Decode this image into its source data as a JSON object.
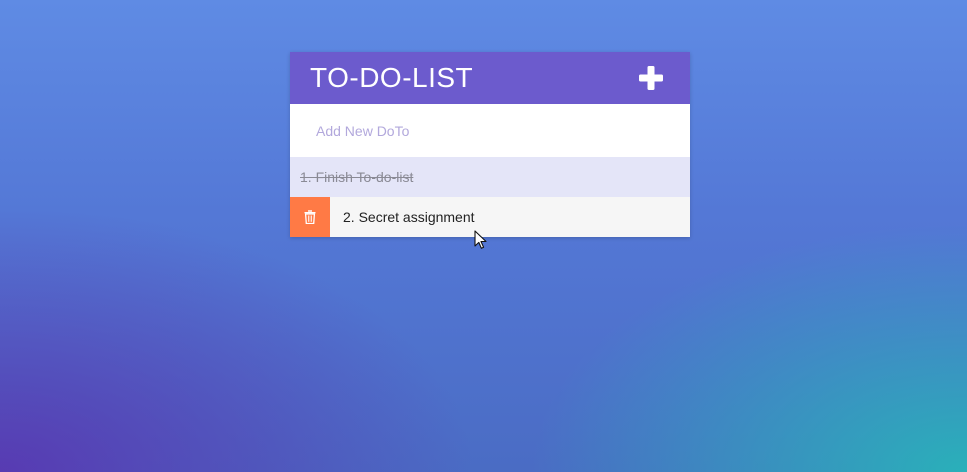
{
  "app": {
    "title": "TO-DO-LIST",
    "add_icon": "plus-icon",
    "colors": {
      "header": "#6c5bcd",
      "delete": "#ff7a45",
      "completed_row": "#e4e5f8",
      "active_row": "#f6f6f6",
      "placeholder": "#b2a8dc"
    }
  },
  "new_todo": {
    "placeholder": "Add New DoTo",
    "value": ""
  },
  "todos": [
    {
      "text": "1. Finish To-do-list",
      "completed": true
    },
    {
      "text": "2. Secret assignment",
      "completed": false,
      "delete_icon": "trash-icon"
    }
  ]
}
